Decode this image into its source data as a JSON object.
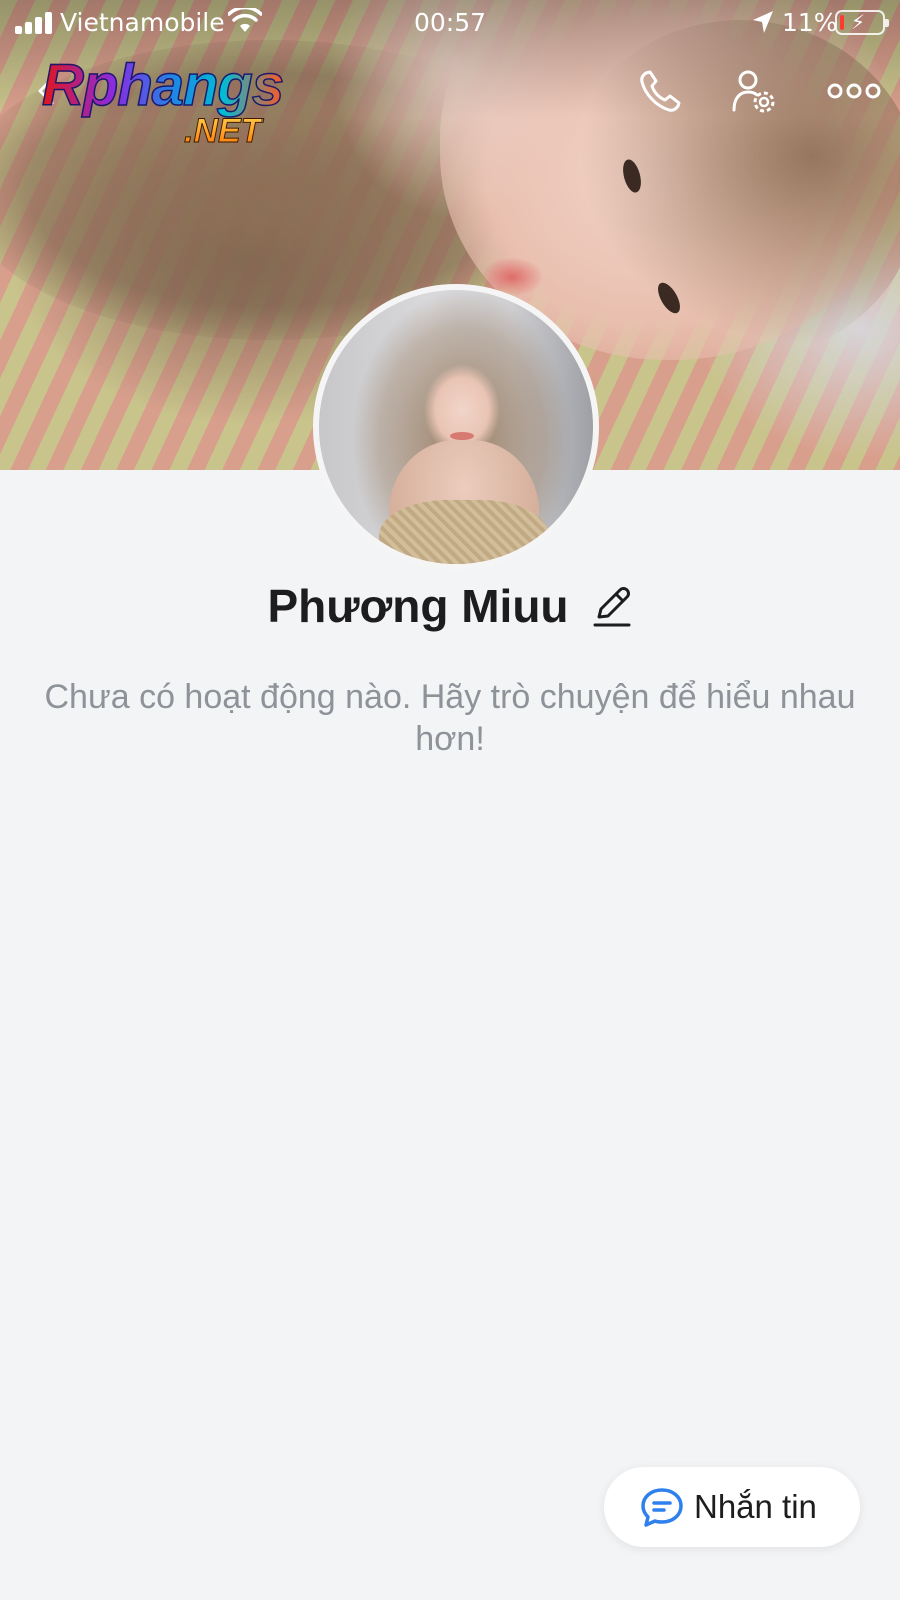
{
  "status_bar": {
    "carrier": "Vietnamobile",
    "time": "00:57",
    "battery_percent": "11%",
    "battery_level": 0.11,
    "battery_color": "#ff3b30"
  },
  "watermark": {
    "main": "Rphangs",
    "sub": ".NET"
  },
  "header": {
    "back_icon": "chevron-left-icon",
    "call_icon": "phone-icon",
    "settings_icon": "user-settings-icon",
    "more_icon": "more-dots-icon"
  },
  "profile": {
    "name": "Phương Miuu",
    "edit_icon": "pencil-icon",
    "empty_message": "Chưa có hoạt động nào. Hãy trò chuyện để hiểu nhau hơn!"
  },
  "message_button": {
    "label": "Nhắn tin",
    "icon": "chat-bubble-icon",
    "icon_color": "#2f80ed"
  }
}
